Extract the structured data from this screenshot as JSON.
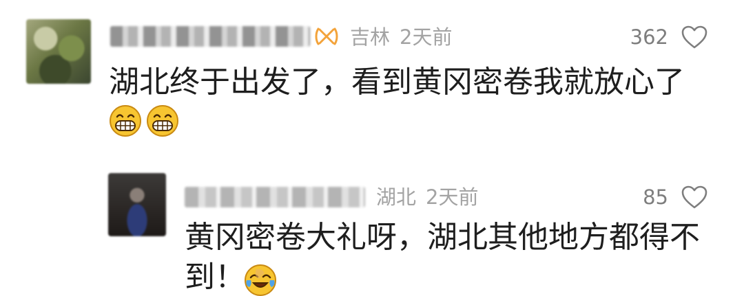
{
  "comments": [
    {
      "location": "吉林",
      "time": "2天前",
      "likes": "362",
      "text": "湖北终于出发了，看到黄冈密卷我就放心了",
      "emojis": [
        "grinning-face",
        "grinning-face"
      ]
    }
  ],
  "reply": {
    "location": "湖北",
    "time": "2天前",
    "likes": "85",
    "text_line1": "黄冈密卷大礼呀，湖北其他地方都得不",
    "text_line2": "到！",
    "emojis": [
      "face-with-tears-of-joy"
    ]
  },
  "icons": {
    "badge": "vip-badge-icon",
    "like": "heart-icon"
  },
  "colors": {
    "meta_text": "#a3a3a3",
    "like_text": "#7e7e7e",
    "comment_text": "#1e1e1e",
    "badge": "#f3a33a"
  }
}
